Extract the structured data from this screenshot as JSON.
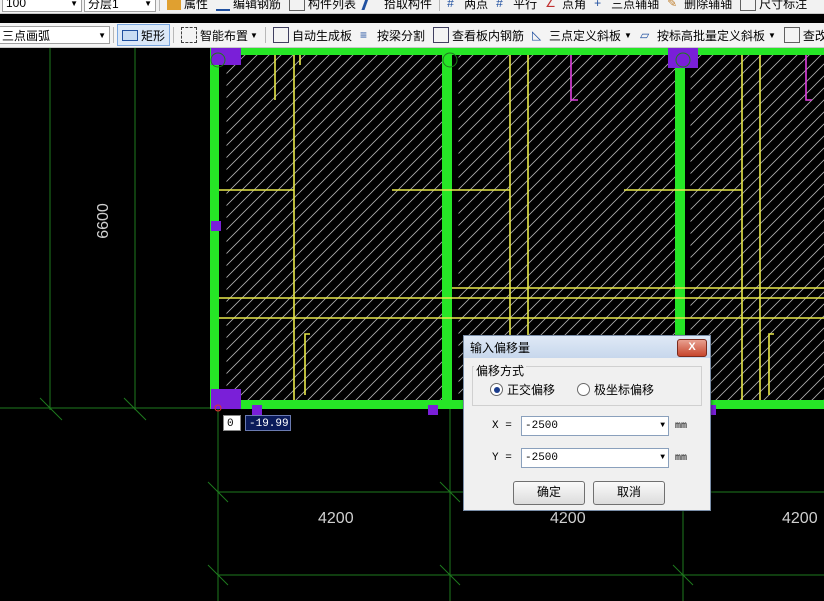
{
  "toolbar1": {
    "scale_value": "100",
    "layer_value": "分层1",
    "buttons": [
      "属性",
      "编辑钢筋",
      "构件列表",
      "拾取构件",
      "两点",
      "平行",
      "点角",
      "三点辅轴",
      "删除辅轴",
      "尺寸标注"
    ]
  },
  "toolbar2": {
    "draw_mode": "三点画弧",
    "buttons": [
      "矩形",
      "智能布置",
      "自动生成板",
      "按梁分割",
      "查看板内钢筋",
      "三点定义斜板",
      "按标高批量定义斜板",
      "查改标高"
    ]
  },
  "canvas": {
    "dimension_vertical": "6600",
    "dimension_bottom": [
      "4200",
      "4200",
      "4200"
    ],
    "coord_input_value": "0",
    "coord_readout": "-19.99",
    "colors": {
      "slab_edge": "#26e626",
      "rebar": "#e8e84a",
      "column": "#7a1fd8",
      "axis": "#1e7a1e",
      "hatch": "#b8b8b8",
      "magenta": "#e040e0"
    }
  },
  "dialog": {
    "title": "输入偏移量",
    "close_glyph": "X",
    "group_label": "偏移方式",
    "radio_orthogonal": "正交偏移",
    "radio_polar": "极坐标偏移",
    "selected_mode": "正交偏移",
    "x_label": "X =",
    "x_value": "-2500",
    "y_label": "Y =",
    "y_value": "-2500",
    "unit": "mm",
    "ok_label": "确定",
    "cancel_label": "取消"
  }
}
